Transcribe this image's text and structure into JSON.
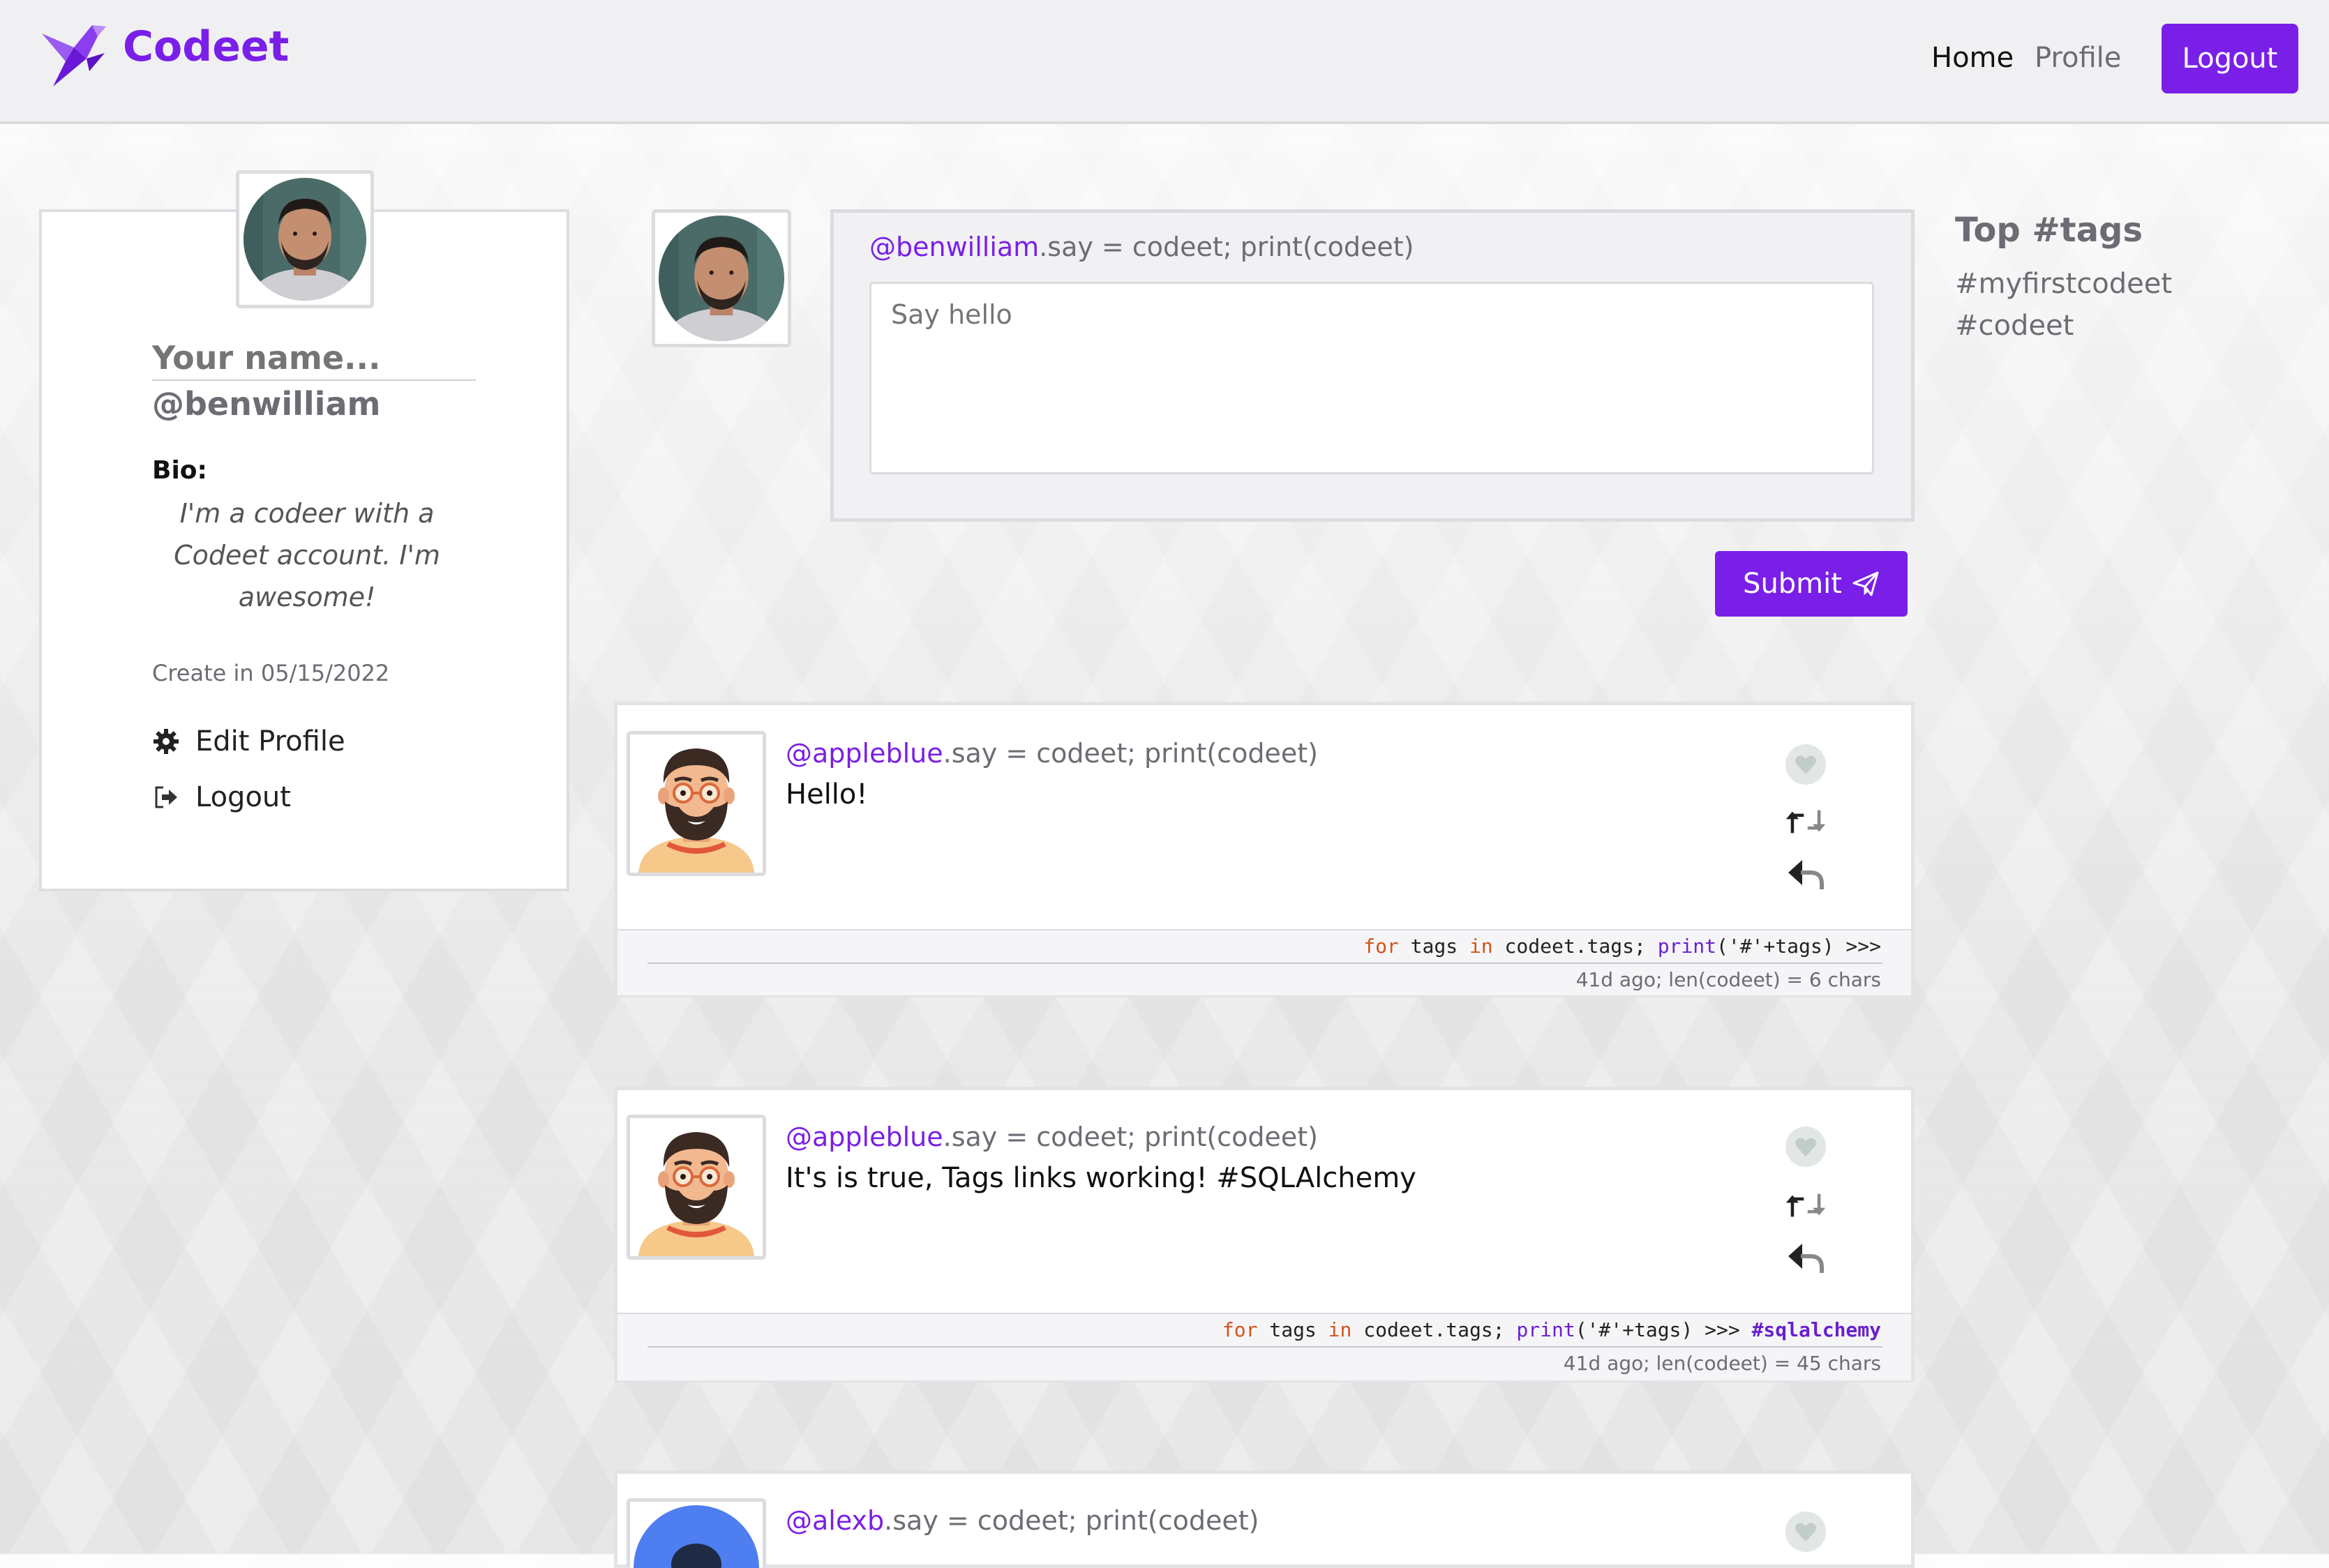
{
  "app": {
    "brand": "Codeet"
  },
  "nav": {
    "home": "Home",
    "profile": "Profile",
    "logout": "Logout"
  },
  "profile": {
    "name_placeholder": "Your name...",
    "handle": "@benwilliam",
    "bio_label": "Bio:",
    "bio": "I'm a codeer with a Codeet account. I'm awesome!",
    "created": "Create in 05/15/2022",
    "edit_profile": "Edit Profile",
    "logout": "Logout"
  },
  "composer": {
    "handle": "@benwilliam",
    "say_suffix": ".say = codeet; print(codeet)",
    "placeholder": "Say hello",
    "submit": "Submit"
  },
  "tags": {
    "title": "Top #tags",
    "items": [
      "#myfirstcodeet",
      "#codeet"
    ]
  },
  "posts": [
    {
      "handle": "@appleblue",
      "say_suffix": ".say = codeet; print(codeet)",
      "text": "Hello!",
      "code": {
        "for": "for",
        "tags": " tags ",
        "in": "in",
        "rest": " codeet.tags; ",
        "print": "print",
        "args": "('#'+tags) >>>",
        "tag": ""
      },
      "meta": "41d ago; len(codeet) = 6 chars"
    },
    {
      "handle": "@appleblue",
      "say_suffix": ".say = codeet; print(codeet)",
      "text": "It's is true, Tags links working! #SQLAlchemy",
      "code": {
        "for": "for",
        "tags": " tags ",
        "in": "in",
        "rest": " codeet.tags; ",
        "print": "print",
        "args": "('#'+tags) >>> ",
        "tag": "#sqlalchemy"
      },
      "meta": "41d ago; len(codeet) = 45 chars"
    },
    {
      "handle": "@alexb",
      "say_suffix": ".say = codeet; print(codeet)",
      "text": "",
      "code": {},
      "meta": ""
    }
  ],
  "icons": {
    "brand_logo": "origami-bird-icon",
    "like": "heart-icon",
    "recodeet": "retweet-icon",
    "reply": "reply-icon",
    "edit": "gear-icon",
    "logout": "logout-icon",
    "submit": "paper-plane-icon"
  },
  "colors": {
    "accent": "#7a1fe8",
    "keyword": "#d1541b",
    "function": "#6a1fd0"
  }
}
